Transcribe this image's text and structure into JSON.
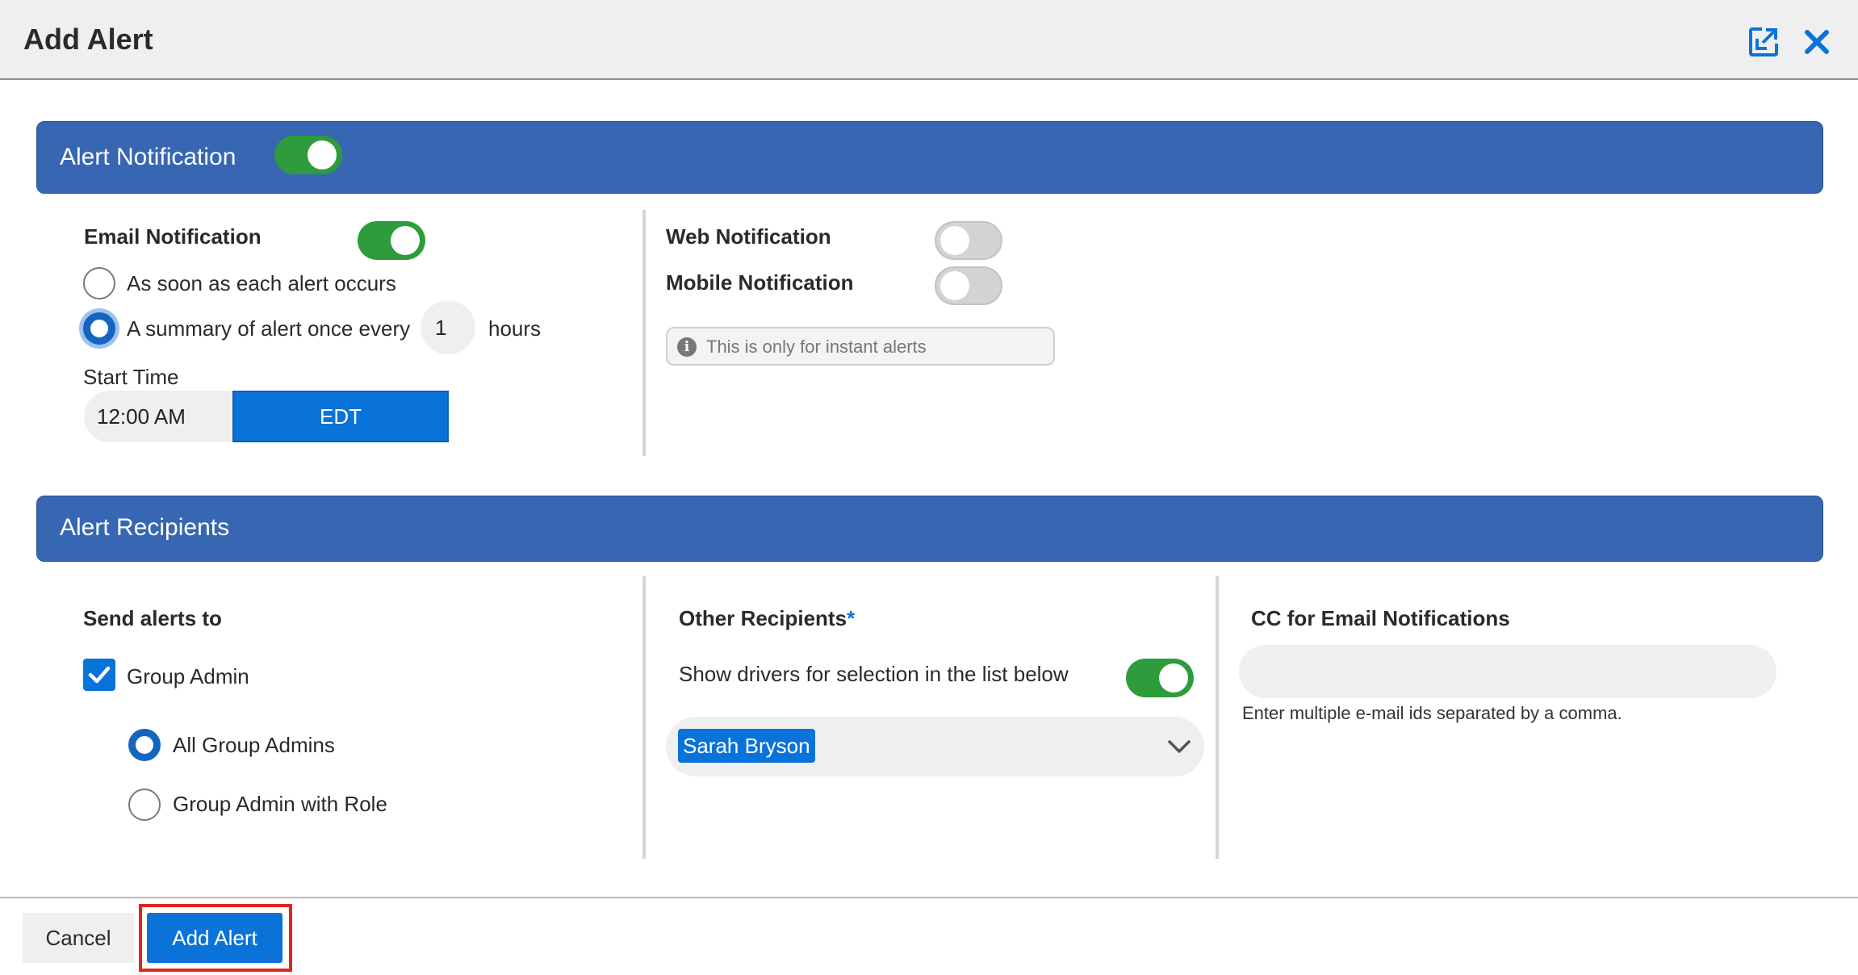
{
  "dialog": {
    "title": "Add Alert",
    "icons": {
      "expand": "expand-icon",
      "close": "close-icon"
    }
  },
  "colors": {
    "accent": "#0a73d9",
    "band": "#3767b2",
    "toggle_on": "#2e9b3c",
    "toggle_off": "#d3d3d3",
    "highlight": "#e0251b"
  },
  "notification_section": {
    "title": "Alert Notification",
    "enabled": true,
    "email": {
      "label": "Email Notification",
      "enabled": true,
      "option_immediate": "As soon as each alert occurs",
      "option_summary": "A summary of alert once every",
      "selected_option": "summary",
      "hours_value": "1",
      "hours_suffix": "hours",
      "start_time_label": "Start Time",
      "start_time_value": "12:00 AM",
      "timezone": "EDT"
    },
    "web": {
      "label": "Web Notification",
      "enabled": false
    },
    "mobile": {
      "label": "Mobile Notification",
      "enabled": false
    },
    "instant_note": "This is only for instant alerts"
  },
  "recipients_section": {
    "title": "Alert Recipients",
    "send_to": {
      "label": "Send alerts to",
      "group_admin_label": "Group Admin",
      "group_admin_checked": true,
      "option_all": "All Group Admins",
      "option_role": "Group Admin with Role",
      "selected_option": "all"
    },
    "other": {
      "label": "Other Recipients",
      "required_marker": "*",
      "show_drivers_label": "Show drivers for selection in the list below",
      "show_drivers_enabled": true,
      "selected_recipient": "Sarah Bryson"
    },
    "cc": {
      "label": "CC for Email Notifications",
      "value": "",
      "hint": "Enter multiple e-mail ids separated by a comma."
    }
  },
  "footer": {
    "cancel_label": "Cancel",
    "submit_label": "Add Alert"
  }
}
